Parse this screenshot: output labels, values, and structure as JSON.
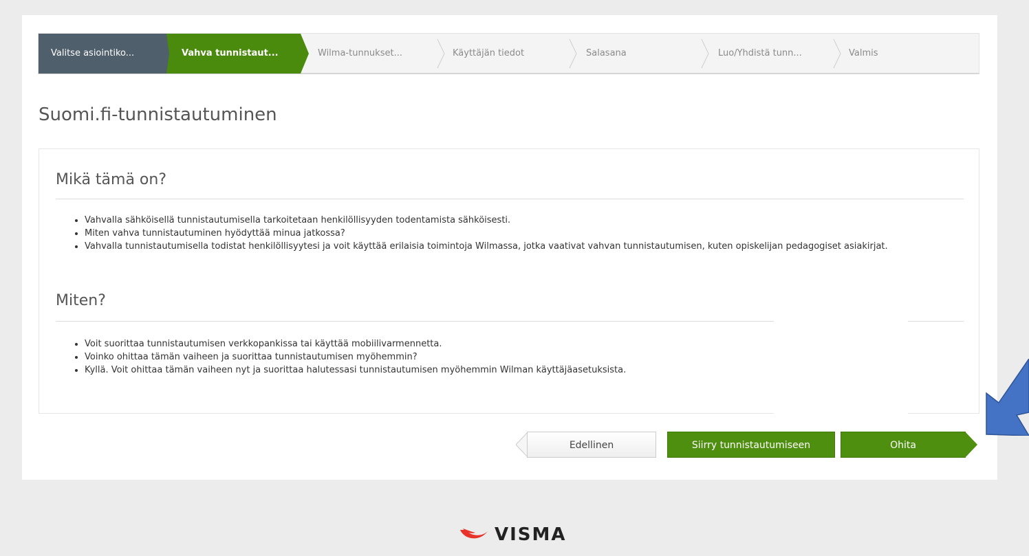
{
  "wizard": {
    "steps": [
      {
        "label": "Valitse asiointiko...",
        "state": "done"
      },
      {
        "label": "Vahva tunnistaut...",
        "state": "active"
      },
      {
        "label": "Wilma-tunnukset...",
        "state": "pending"
      },
      {
        "label": "Käyttäjän tiedot",
        "state": "pending"
      },
      {
        "label": "Salasana",
        "state": "pending"
      },
      {
        "label": "Luo/Yhdistä tunn...",
        "state": "pending"
      },
      {
        "label": "Valmis",
        "state": "pending"
      }
    ]
  },
  "page_title": "Suomi.fi-tunnistautuminen",
  "sections": [
    {
      "title": "Mikä tämä on?",
      "bullets": [
        "Vahvalla sähköisellä tunnistautumisella tarkoitetaan henkilöllisyyden todentamista sähköisesti.",
        "Miten vahva tunnistautuminen hyödyttää minua jatkossa?",
        "Vahvalla tunnistautumisella todistat henkilöllisyytesi ja voit käyttää erilaisia toimintoja Wilmassa, jotka vaativat vahvan tunnistautumisen, kuten opiskelijan pedagogiset asiakirjat."
      ]
    },
    {
      "title": "Miten?",
      "bullets": [
        "Voit suorittaa tunnistautumisen verkkopankissa tai käyttää mobiilivarmennetta.",
        "Voinko ohittaa tämän vaiheen ja suorittaa tunnistautumisen myöhemmin?",
        "Kyllä. Voit ohittaa tämän vaiheen nyt ja suorittaa halutessasi tunnistautumisen myöhemmin Wilman käyttäjäasetuksista."
      ]
    }
  ],
  "buttons": {
    "previous": "Edellinen",
    "go_to_auth": "Siirry tunnistautumiseen",
    "skip": "Ohita"
  },
  "footer": {
    "logo_text": "VISMA"
  },
  "colors": {
    "done_step": "#4f5f6b",
    "active_step": "#4a8a0c",
    "primary_button": "#4f8f0f",
    "annotation_arrow": "#4472c4",
    "logo_red": "#e8332a"
  }
}
